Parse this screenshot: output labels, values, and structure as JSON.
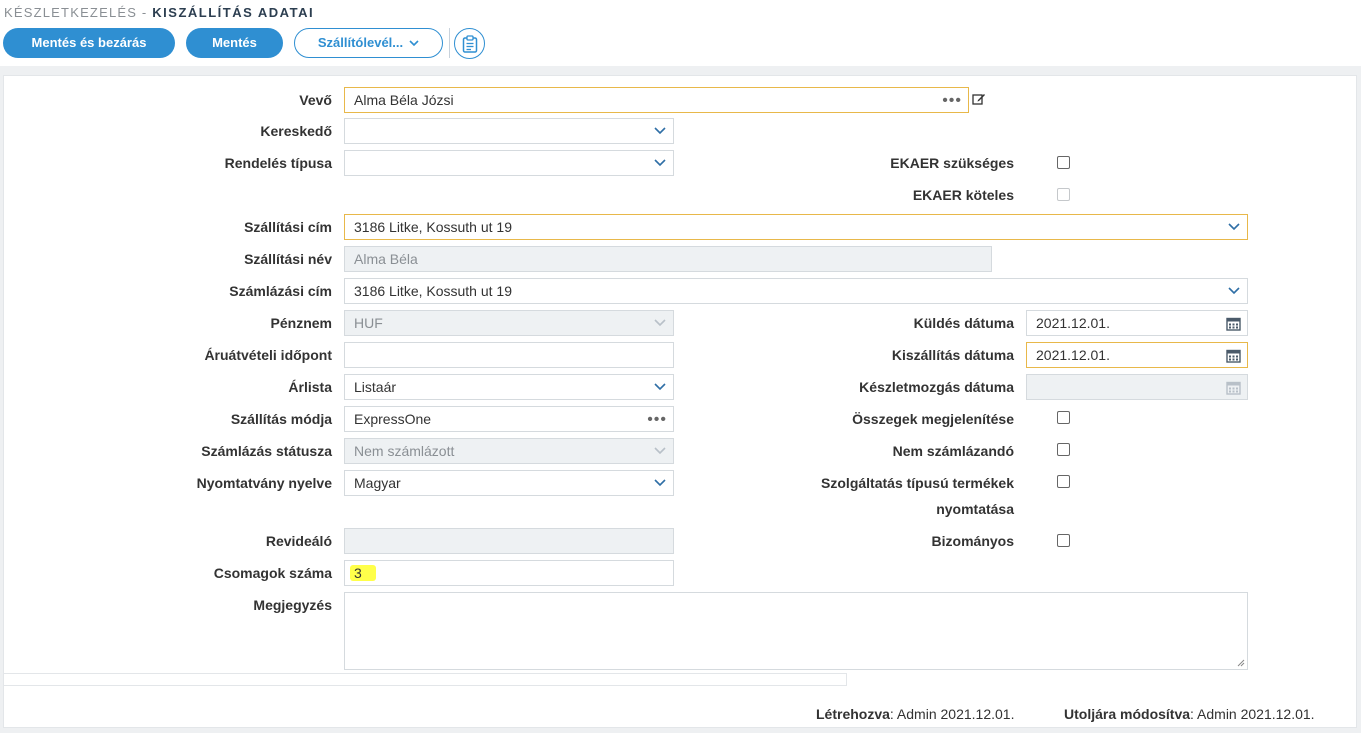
{
  "header": {
    "breadcrumb_parent": "KÉSZLETKEZELÉS",
    "breadcrumb_sep": " - ",
    "title": "KISZÁLLÍTÁS ADATAI"
  },
  "toolbar": {
    "save_close_label": "Mentés és bezárás",
    "save_label": "Mentés",
    "delivery_note_label": "Szállítólevél...",
    "clipboard_icon": "clipboard-icon"
  },
  "form": {
    "vevo": {
      "label": "Vevő",
      "value": "Alma Béla Józsi"
    },
    "kereskedo": {
      "label": "Kereskedő",
      "value": ""
    },
    "rendeles_tipusa": {
      "label": "Rendelés típusa",
      "value": ""
    },
    "szallitasi_cim": {
      "label": "Szállítási cím",
      "value": "3186 Litke, Kossuth ut 19"
    },
    "szallitasi_nev": {
      "label": "Szállítási név",
      "value": "Alma Béla"
    },
    "szamlazasi_cim": {
      "label": "Számlázási cím",
      "value": "3186 Litke, Kossuth ut 19"
    },
    "penznem": {
      "label": "Pénznem",
      "value": "HUF"
    },
    "aruatveteli_idopont": {
      "label": "Áruátvételi időpont",
      "value": ""
    },
    "arlista": {
      "label": "Árlista",
      "value": "Listaár"
    },
    "szallitas_modja": {
      "label": "Szállítás módja",
      "value": "ExpressOne"
    },
    "szamlazas_statusza": {
      "label": "Számlázás státusza",
      "value": "Nem számlázott"
    },
    "nyomtatvany_nyelve": {
      "label": "Nyomtatvány nyelve",
      "value": "Magyar"
    },
    "revidealo": {
      "label": "Revideáló",
      "value": ""
    },
    "csomagok_szama": {
      "label": "Csomagok száma",
      "value": "3"
    },
    "megjegyzes": {
      "label": "Megjegyzés",
      "value": ""
    },
    "ekaer_szukseges": {
      "label": "EKAER szükséges",
      "checked": false
    },
    "ekaer_koteles": {
      "label": "EKAER köteles",
      "checked": false
    },
    "kuldes_datuma": {
      "label": "Küldés dátuma",
      "value": "2021.12.01."
    },
    "kiszallitas_datuma": {
      "label": "Kiszállítás dátuma",
      "value": "2021.12.01."
    },
    "keszletmozgas_datuma": {
      "label": "Készletmozgás dátuma",
      "value": ""
    },
    "osszegek_megjelenitese": {
      "label": "Összegek megjelenítése",
      "checked": false
    },
    "nem_szamlazando": {
      "label": "Nem számlázandó",
      "checked": false
    },
    "szolgaltatas_tipusu": {
      "label_line1": "Szolgáltatás típusú termékek",
      "label_line2": "nyomtatása",
      "checked": false
    },
    "bizomanyos": {
      "label": "Bizományos",
      "checked": false
    }
  },
  "footer": {
    "created_label": "Létrehozva",
    "created_value": ": Admin 2021.12.01.",
    "modified_label": "Utoljára módosítva",
    "modified_value": ": Admin 2021.12.01."
  },
  "colors": {
    "accent": "#2f8fd2",
    "focus_border": "#e8b84a",
    "highlight": "#ffff4a"
  }
}
